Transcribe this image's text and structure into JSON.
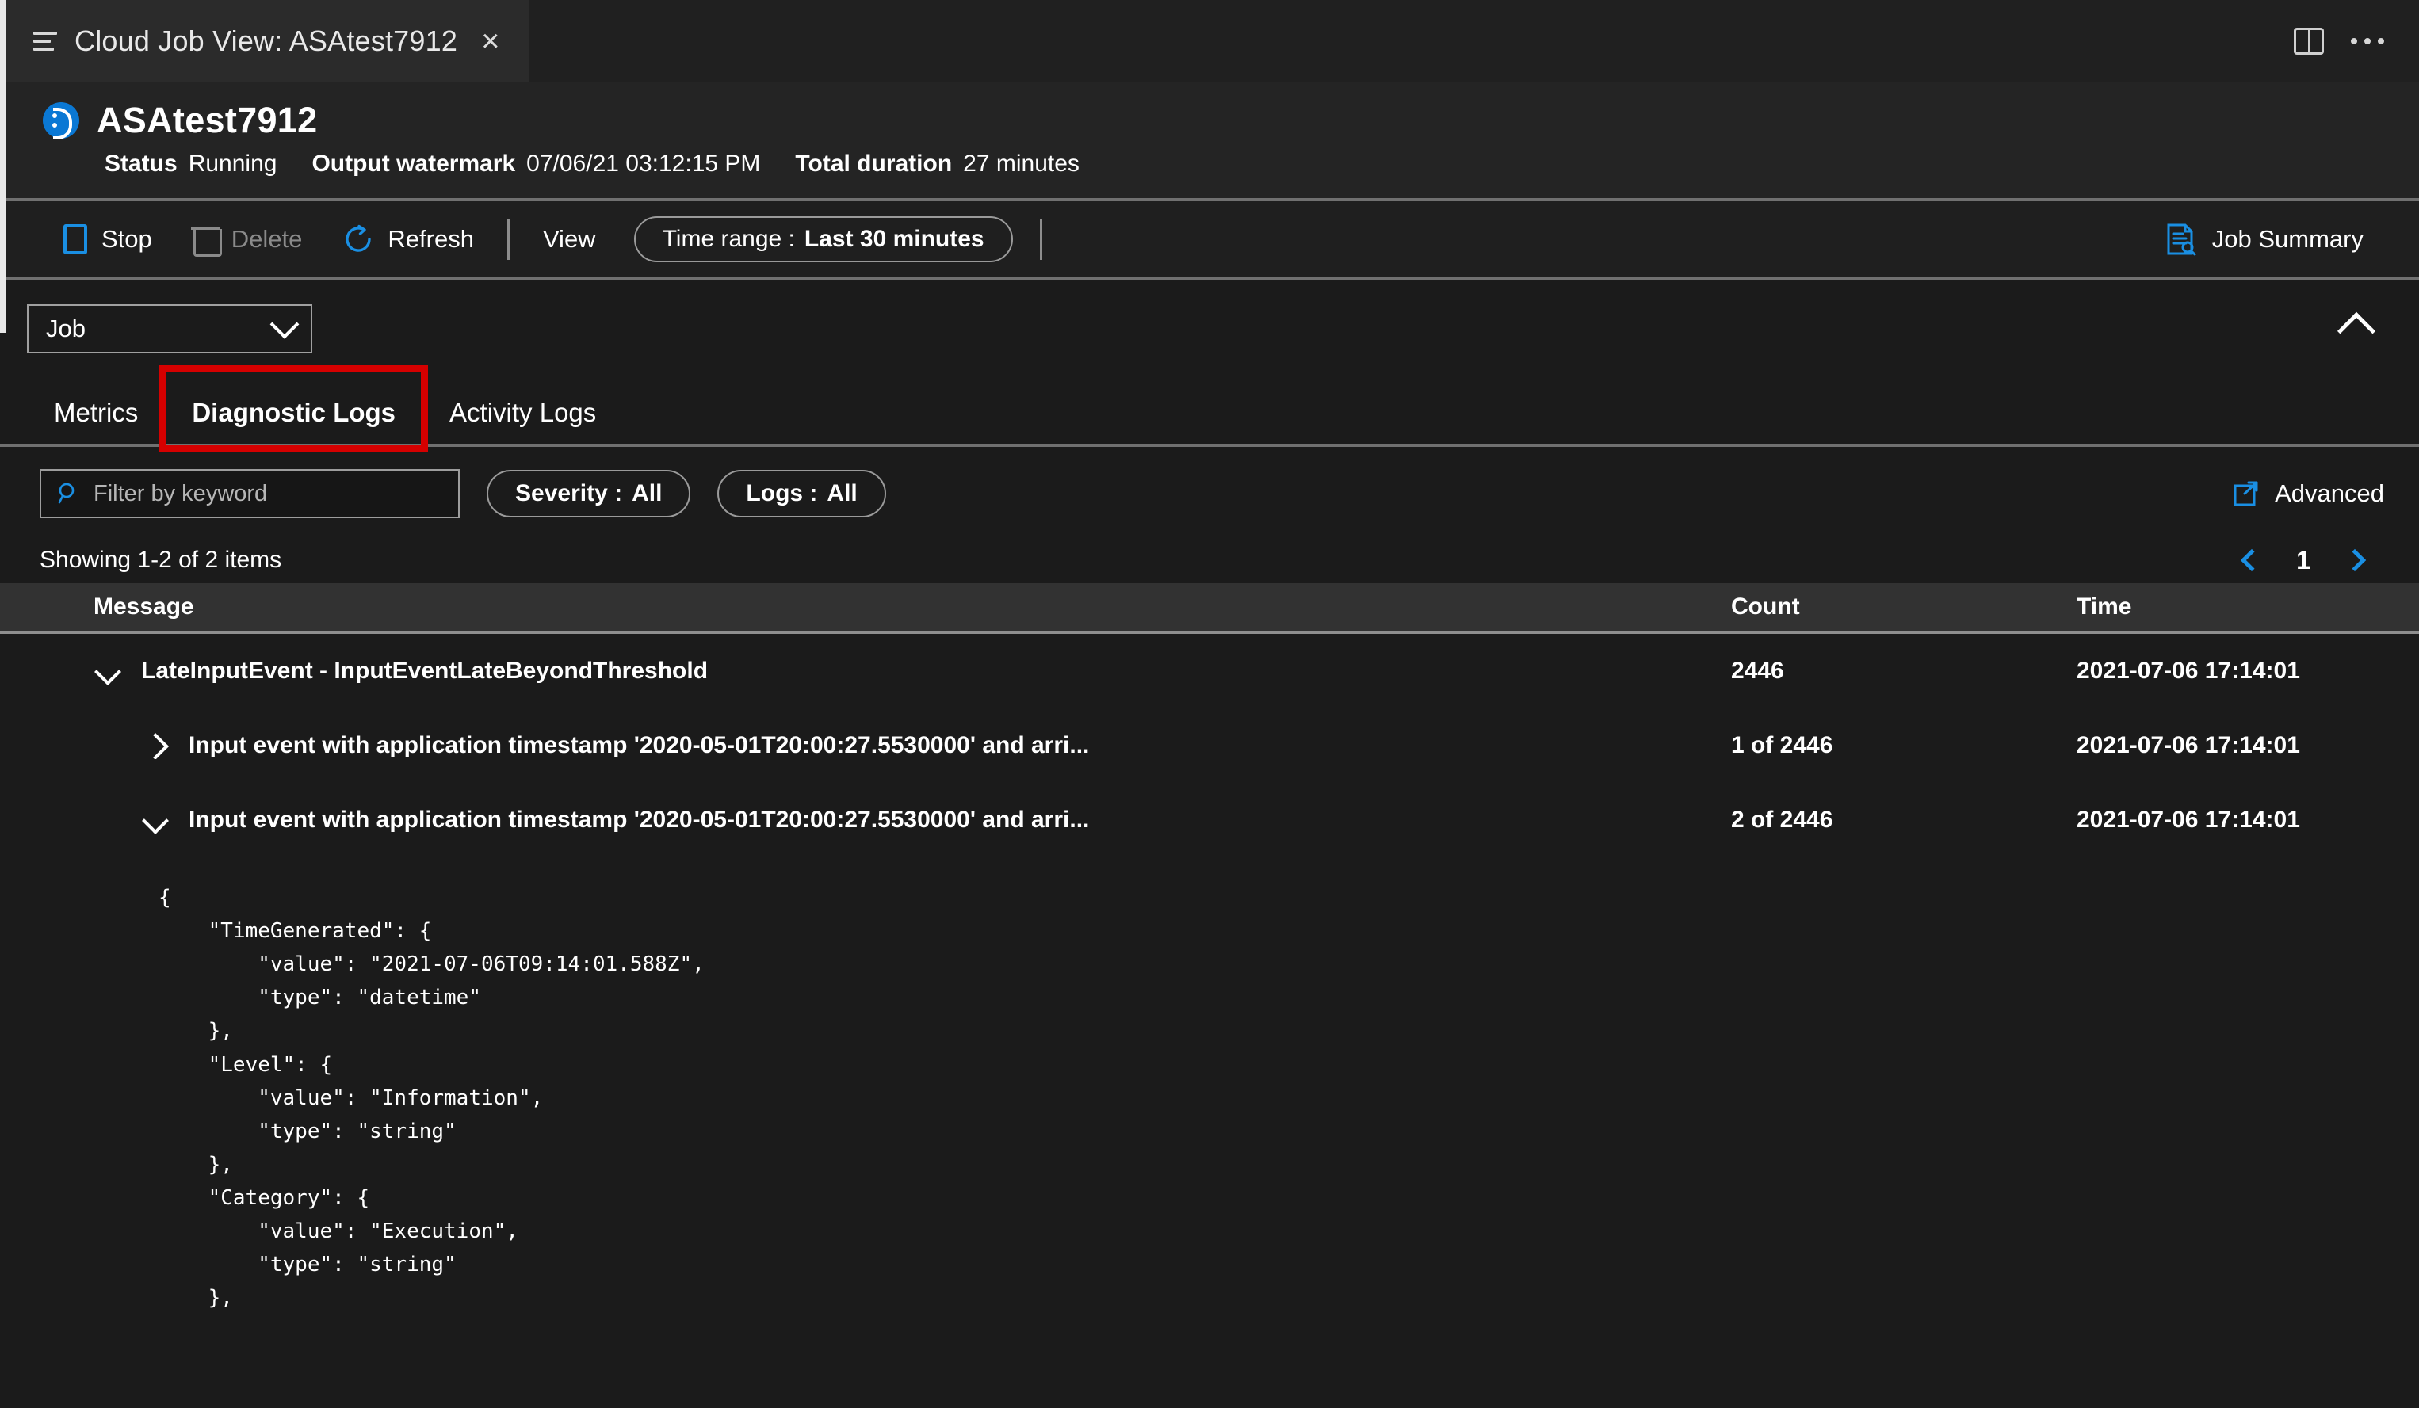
{
  "window": {
    "tab_title": "Cloud Job View: ASAtest7912",
    "close_label": "×",
    "split_icon": "split-editor-icon",
    "more_icon": "ellipsis-icon"
  },
  "job_header": {
    "name": "ASAtest7912",
    "status_key": "Status",
    "status_value": "Running",
    "watermark_key": "Output watermark",
    "watermark_value": "07/06/21 03:12:15 PM",
    "duration_key": "Total duration",
    "duration_value": "27 minutes"
  },
  "commandbar": {
    "stop": "Stop",
    "delete": "Delete",
    "refresh": "Refresh",
    "view": "View",
    "time_range_key": "Time range :",
    "time_range_value": "Last 30 minutes",
    "job_summary": "Job Summary"
  },
  "scope": {
    "selected": "Job",
    "options": [
      "Job"
    ],
    "collapse_icon": "chevron-up-icon"
  },
  "tabs": [
    {
      "label": "Metrics",
      "active": false,
      "highlighted": false
    },
    {
      "label": "Diagnostic Logs",
      "active": true,
      "highlighted": true
    },
    {
      "label": "Activity Logs",
      "active": false,
      "highlighted": false
    }
  ],
  "filters": {
    "search_placeholder": "Filter by keyword",
    "search_value": "",
    "severity_key": "Severity :",
    "severity_value": "All",
    "logs_key": "Logs :",
    "logs_value": "All",
    "advanced": "Advanced"
  },
  "paging": {
    "showing": "Showing 1-2 of 2 items",
    "page": "1",
    "prev_icon": "chevron-left-icon",
    "next_icon": "chevron-right-icon"
  },
  "grid": {
    "columns": [
      "Message",
      "Count",
      "Time"
    ],
    "rows": [
      {
        "level": 1,
        "expanded": true,
        "message": "LateInputEvent - InputEventLateBeyondThreshold",
        "count": "2446",
        "time": "2021-07-06 17:14:01"
      },
      {
        "level": 2,
        "expanded": false,
        "message": "Input event with application timestamp '2020-05-01T20:00:27.5530000' and arri...",
        "count": "1 of 2446",
        "time": "2021-07-06 17:14:01"
      },
      {
        "level": 2,
        "expanded": true,
        "message": "Input event with application timestamp '2020-05-01T20:00:27.5530000' and arri...",
        "count": "2 of 2446",
        "time": "2021-07-06 17:14:01"
      }
    ],
    "detail_json": "{\n    \"TimeGenerated\": {\n        \"value\": \"2021-07-06T09:14:01.588Z\",\n        \"type\": \"datetime\"\n    },\n    \"Level\": {\n        \"value\": \"Information\",\n        \"type\": \"string\"\n    },\n    \"Category\": {\n        \"value\": \"Execution\",\n        \"type\": \"string\"\n    },"
  },
  "colors": {
    "accent": "#1a8fe3",
    "highlight": "#d50000",
    "app_bg": "#1b1b1b",
    "header_bg": "#242424",
    "grid_header_bg": "#323232"
  }
}
